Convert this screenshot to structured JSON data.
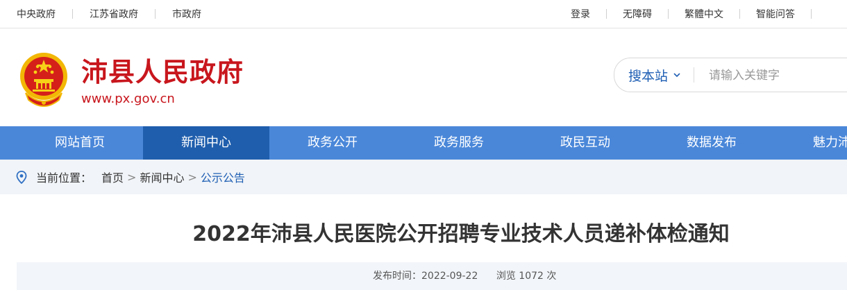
{
  "topbar": {
    "left_links": [
      "中央政府",
      "江苏省政府",
      "市政府"
    ],
    "right_links": [
      "登录",
      "无障碍",
      "繁體中文",
      "智能问答"
    ]
  },
  "header": {
    "site_title": "沛县人民政府",
    "site_url": "www.px.gov.cn",
    "emblem_icon": "national-emblem-icon",
    "brand_color": "#c8161d"
  },
  "search": {
    "scope_label": "搜本站",
    "placeholder": "请输入关键字"
  },
  "nav": {
    "items": [
      "网站首页",
      "新闻中心",
      "政务公开",
      "政务服务",
      "政民互动",
      "数据发布",
      "魅力沛县"
    ],
    "active_index": 1,
    "color": "#4a87d9",
    "active_color": "#1f5ead"
  },
  "breadcrumb": {
    "prefix": "当前位置：",
    "items": [
      "首页",
      "新闻中心",
      "公示公告"
    ],
    "separator": ">"
  },
  "article": {
    "title": "2022年沛县人民医院公开招聘专业技术人员递补体检通知",
    "publish_label": "发布时间：",
    "publish_date": "2022-09-22",
    "views_label": "浏览",
    "views_count": "1072",
    "views_unit": "次"
  }
}
